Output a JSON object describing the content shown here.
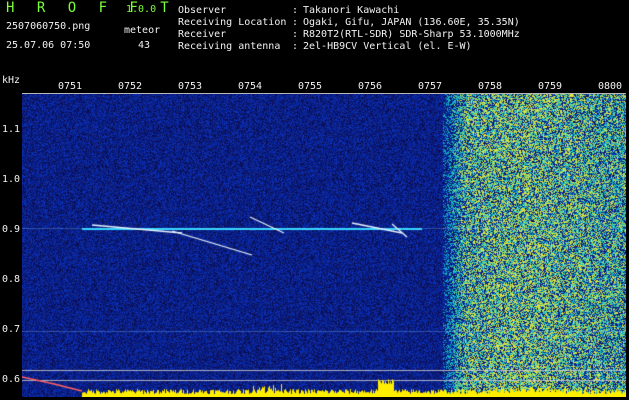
{
  "header": {
    "title": "H R O F F T",
    "version": "1.0.0",
    "filename": "2507060750.png",
    "datetime": "25.07.06 07:50",
    "mode": "meteor",
    "count": "43"
  },
  "info": [
    {
      "key": "Observer",
      "value": "Takanori Kawachi"
    },
    {
      "key": "Receiving Location",
      "value": "Ogaki, Gifu, JAPAN (136.60E, 35.35N)"
    },
    {
      "key": "Receiver",
      "value": "R820T2(RTL-SDR) SDR-Sharp 53.1000MHz"
    },
    {
      "key": "Receiving antenna",
      "value": "2el-HB9CV Vertical (el. E-W)"
    }
  ],
  "colon": ":",
  "axis": {
    "unit": "kHz",
    "x_ticks": [
      "0751",
      "0752",
      "0753",
      "0754",
      "0755",
      "0756",
      "0757",
      "0758",
      "0759",
      "0800"
    ],
    "y_ticks": [
      "1.1",
      "1.0",
      "0.9",
      "0.8",
      "0.7",
      "0.6"
    ]
  },
  "colors": {
    "header_green": "#7CFF3A",
    "text_white": "#f2f2f2",
    "tone_cyan": "#39d7ff",
    "signal_yellow": "#ffee00",
    "spectrum_background": "#03034a"
  }
}
